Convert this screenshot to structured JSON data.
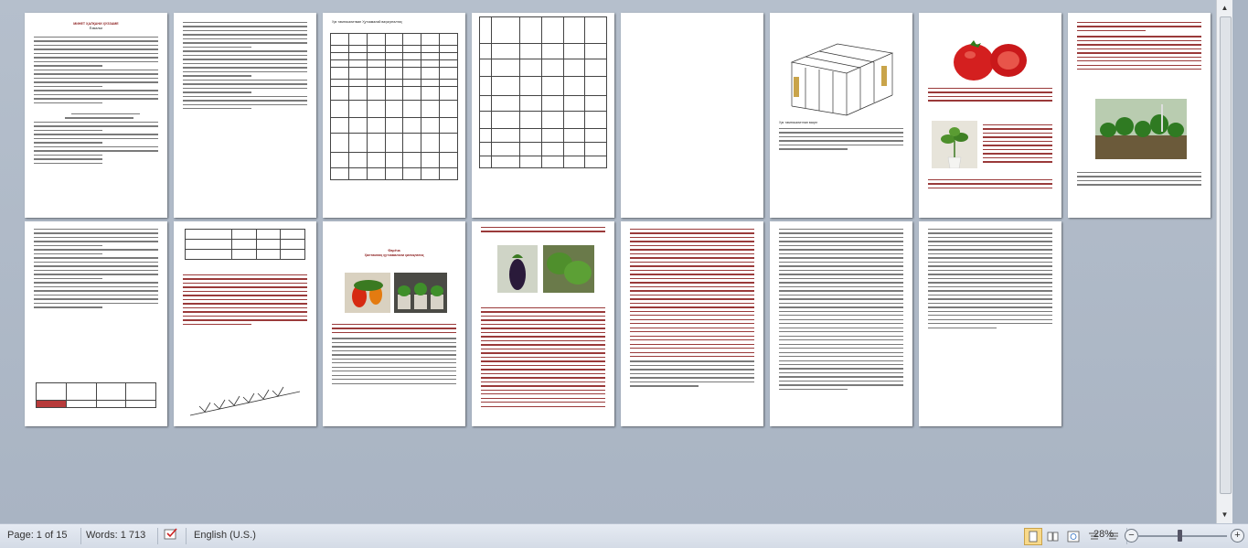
{
  "statusbar": {
    "page_info": "Page: 1 of 15",
    "words": "Words: 1 713",
    "language": "English (U.S.)",
    "zoom": "28%",
    "zoom_out": "−",
    "zoom_in": "+"
  },
  "pages": [
    {
      "id": 1,
      "heading": "МИНЕТ ҲАЛҚАНИ ҲУЗЗАМЕ",
      "subheading": "Ёзмалки"
    },
    {
      "id": 2
    },
    {
      "id": 3,
      "heading": "Ҳаг тамтикалитман Ҳутзамалай ваҳаҳиталтиқ"
    },
    {
      "id": 4
    },
    {
      "id": 5,
      "caption": "Ҳаг тамтикалитлан ваҳат"
    },
    {
      "id": 6
    },
    {
      "id": 7
    },
    {
      "id": 8
    },
    {
      "id": 9
    },
    {
      "id": 10,
      "heading": "Фарёча",
      "subheading": "Ҳилтамлиқ ҳутзамалали қилиқлатиқ"
    },
    {
      "id": 11
    },
    {
      "id": 12
    },
    {
      "id": 13
    },
    {
      "id": 14
    }
  ]
}
